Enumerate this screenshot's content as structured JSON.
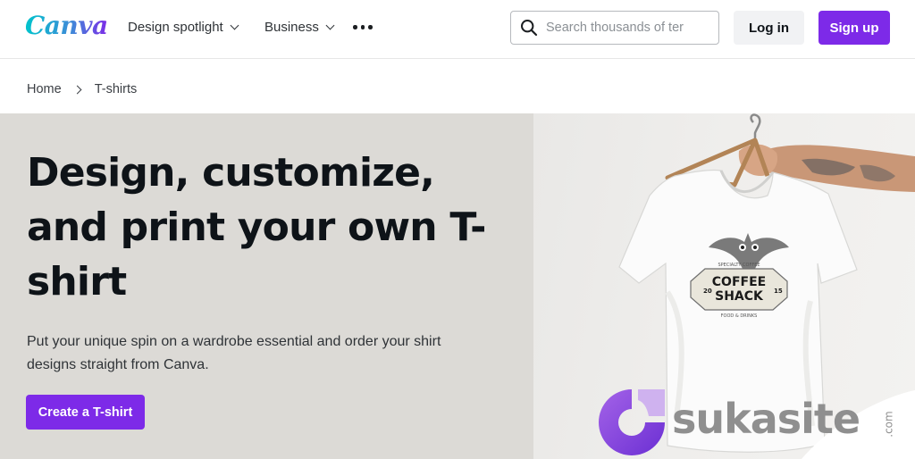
{
  "brand": {
    "logo_text": "Canva",
    "accent": "#7d2ae8"
  },
  "nav": {
    "items": [
      {
        "label": "Design spotlight",
        "has_dropdown": true
      },
      {
        "label": "Business",
        "has_dropdown": true
      }
    ],
    "more_icon": "more-horizontal-icon"
  },
  "search": {
    "placeholder": "Search thousands of ter",
    "value": "",
    "icon": "search-icon"
  },
  "auth": {
    "login_label": "Log in",
    "signup_label": "Sign up"
  },
  "breadcrumb": {
    "home": "Home",
    "current": "T-shirts"
  },
  "hero": {
    "title": "Design, customize, and print your own T-shirt",
    "subtitle": "Put your unique spin on a wardrobe essential and order your shirt designs straight from Canva.",
    "cta_label": "Create a T-shirt",
    "background": "#dcdad6"
  },
  "shirt_print": {
    "top_text": "SPECIALTY COFFEE",
    "line1": "COFFEE",
    "line2": "SHACK",
    "year_left": "20",
    "year_right": "15",
    "bottom_text": "FOOD & DRINKS"
  },
  "watermark": {
    "text": "sukasite",
    "suffix": ".com",
    "color": "#8f8f8f"
  }
}
